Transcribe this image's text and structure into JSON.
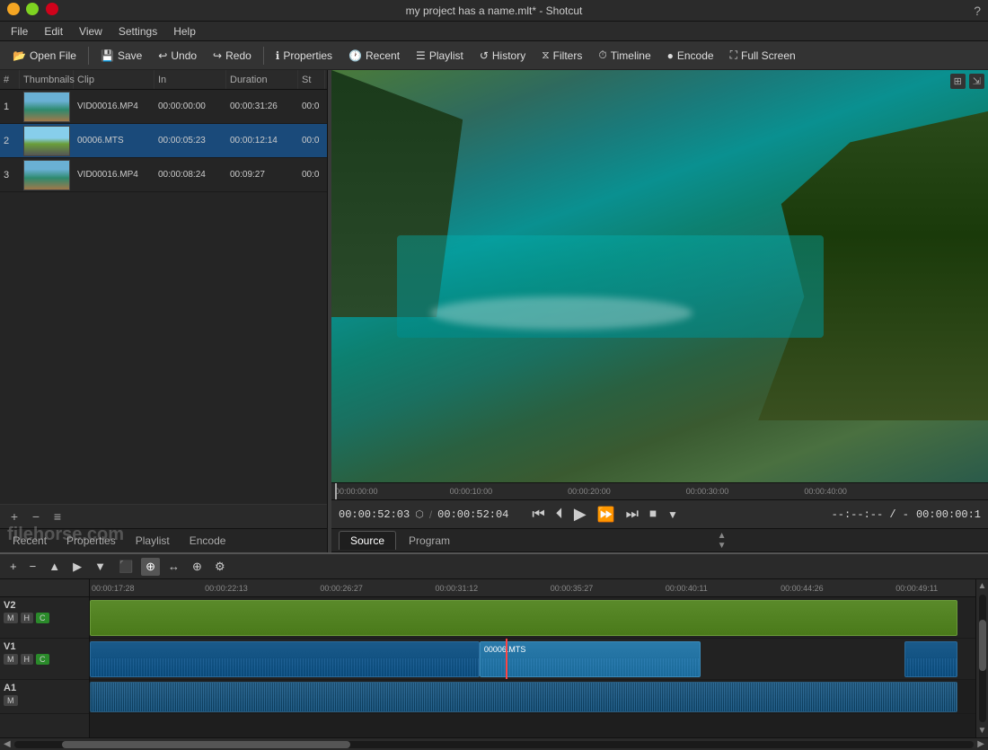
{
  "window": {
    "title": "my project has a name.mlt* - Shotcut",
    "min_btn": "─",
    "max_btn": "□",
    "close_btn": "✕"
  },
  "menu": {
    "items": [
      "File",
      "Edit",
      "View",
      "Settings",
      "Help"
    ]
  },
  "toolbar": {
    "buttons": [
      {
        "id": "open-file",
        "icon": "📂",
        "label": "Open File"
      },
      {
        "id": "save",
        "icon": "💾",
        "label": "Save"
      },
      {
        "id": "undo",
        "icon": "↩",
        "label": "Undo"
      },
      {
        "id": "redo",
        "icon": "↪",
        "label": "Redo"
      },
      {
        "id": "properties",
        "icon": "ℹ",
        "label": "Properties"
      },
      {
        "id": "recent",
        "icon": "🕐",
        "label": "Recent"
      },
      {
        "id": "playlist",
        "icon": "☰",
        "label": "Playlist"
      },
      {
        "id": "history",
        "icon": "↺",
        "label": "History"
      },
      {
        "id": "filters",
        "icon": "⧖",
        "label": "Filters"
      },
      {
        "id": "timeline",
        "icon": "⏱",
        "label": "Timeline"
      },
      {
        "id": "encode",
        "icon": "●",
        "label": "Encode"
      },
      {
        "id": "fullscreen",
        "icon": "⛶",
        "label": "Full Screen"
      }
    ]
  },
  "playlist": {
    "columns": [
      "#",
      "Thumbnails",
      "Clip",
      "In",
      "Duration",
      "St"
    ],
    "rows": [
      {
        "num": "1",
        "clip": "VID00016.MP4",
        "in": "00:00:00:00",
        "duration": "00:00:31:26",
        "st": "00:0"
      },
      {
        "num": "2",
        "clip": "00006.MTS",
        "in": "00:00:05:23",
        "duration": "00:00:12:14",
        "st": "00:0",
        "selected": true
      },
      {
        "num": "3",
        "clip": "VID00016.MP4",
        "in": "00:00:08:24",
        "duration": "00:09:27",
        "st": "00:0"
      }
    ]
  },
  "left_panel": {
    "toolbar_icons": [
      "+",
      "−",
      "≡"
    ],
    "tabs": [
      "Recent",
      "Properties",
      "Playlist",
      "Encode"
    ]
  },
  "preview": {
    "timecode_start": "00:00:00:00",
    "timecode_marks": [
      "00:00:10:00",
      "00:00:20:00",
      "00:00:30:00",
      "00:00:40:00"
    ],
    "current_time": "00:00:52:03",
    "total_time": "00:00:52:04",
    "right_time": "00:00:00:1",
    "duration_display": "--:--:-- / -"
  },
  "transport": {
    "skip_start": "⏮",
    "prev_frame": "⏴",
    "play": "▶",
    "fast_forward": "⏩",
    "skip_end": "⏭",
    "stop": "⏹",
    "more": "▼"
  },
  "source_tabs": {
    "tabs": [
      "Source",
      "Program"
    ],
    "active": "Source"
  },
  "timeline": {
    "ruler_marks": [
      "00:00:17:28",
      "00:00:22:13",
      "00:00:26:27",
      "00:00:31:12",
      "00:00:35:27",
      "00:00:40:11",
      "00:00:44:26",
      "00:00:49:11"
    ],
    "toolbar_icons": [
      "+",
      "−",
      "▲",
      "▶",
      "▼",
      "⬛",
      "⊕",
      "↔",
      "⊕",
      "⚙"
    ],
    "tracks": [
      {
        "name": "V2",
        "type": "video"
      },
      {
        "name": "V1",
        "type": "video"
      },
      {
        "name": "A1",
        "type": "audio"
      }
    ],
    "clips": {
      "v2": [
        {
          "label": "",
          "color": "green",
          "left": "0%",
          "width": "98%"
        }
      ],
      "v1": [
        {
          "label": "",
          "color": "blue",
          "left": "0%",
          "width": "44%"
        },
        {
          "label": "00006.MTS",
          "color": "blue-bright",
          "left": "44%",
          "width": "32%"
        },
        {
          "label": "",
          "color": "blue",
          "left": "93%",
          "width": "7%"
        }
      ],
      "a1": [
        {
          "label": "",
          "left": "0%",
          "width": "98%"
        }
      ]
    }
  },
  "watermark": "filehorse.com"
}
